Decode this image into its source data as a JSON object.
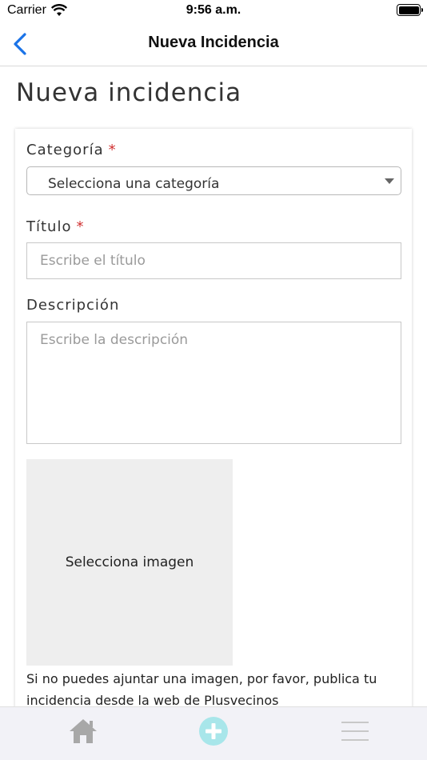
{
  "status_bar": {
    "carrier": "Carrier",
    "time": "9:56 a.m.",
    "icons": [
      "wifi-icon",
      "battery-icon"
    ]
  },
  "nav": {
    "title": "Nueva Incidencia",
    "back_icon": "chevron-left-icon",
    "accent_color": "#1a73e8"
  },
  "page": {
    "title": "Nueva incidencia"
  },
  "form": {
    "category": {
      "label": "Categoría",
      "required_mark": "*",
      "selected": "Selecciona una categoría"
    },
    "title": {
      "label": "Título",
      "required_mark": "*",
      "value": "",
      "placeholder": "Escribe el título"
    },
    "description": {
      "label": "Descripción",
      "value": "",
      "placeholder": "Escribe la descripción"
    },
    "image": {
      "label": "Selecciona imagen"
    },
    "help_text": "Si no puedes ajuntar una imagen, por favor, publica tu incidencia desde la web de Plusvecinos"
  },
  "tab_bar": {
    "tabs": [
      {
        "name": "home",
        "icon": "home-icon",
        "color": "#a8a8a8"
      },
      {
        "name": "add",
        "icon": "plus-circle-icon",
        "color": "#a8e6ea"
      },
      {
        "name": "menu",
        "icon": "hamburger-menu-icon",
        "color": "#c8c8c8"
      }
    ]
  },
  "colors": {
    "required": "#d03030",
    "image_placeholder_bg": "#eeeeee",
    "tab_bar_bg": "#f2f2f7"
  }
}
